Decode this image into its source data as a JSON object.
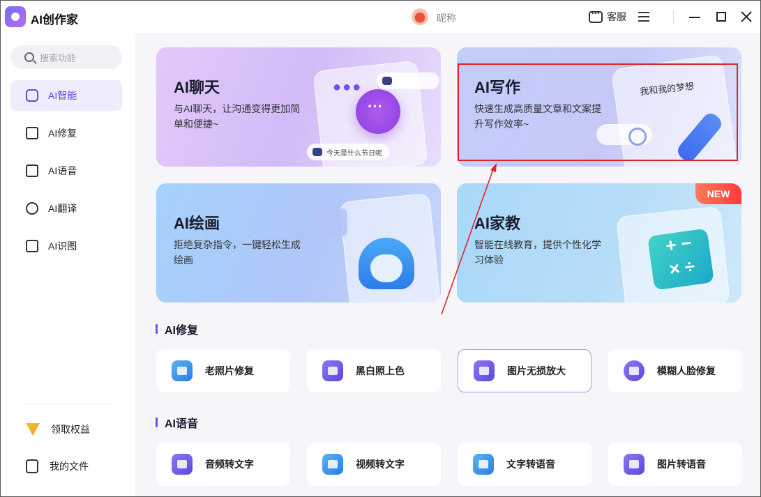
{
  "app": {
    "title": "AI创作家",
    "nickname": "昵称",
    "service_label": "客服"
  },
  "sidebar": {
    "search_placeholder": "搜索功能",
    "items": [
      {
        "label": "AI智能",
        "icon": "ai-smart-icon",
        "active": true
      },
      {
        "label": "AI修复",
        "icon": "repair-icon"
      },
      {
        "label": "AI语音",
        "icon": "voice-icon"
      },
      {
        "label": "AI翻译",
        "icon": "translate-icon"
      },
      {
        "label": "AI识图",
        "icon": "image-recognition-icon"
      }
    ],
    "bottom": [
      {
        "label": "领取权益",
        "icon": "gift-icon"
      },
      {
        "label": "我的文件",
        "icon": "file-icon"
      }
    ]
  },
  "cards": [
    {
      "title": "AI聊天",
      "desc": "与AI聊天，让沟通变得更加简单和便捷~",
      "tag": "今天是什么节日呢"
    },
    {
      "title": "AI写作",
      "desc": "快速生成高质量文章和文案提升写作效率~",
      "paper": "我和我的梦想"
    },
    {
      "title": "AI绘画",
      "desc": "拒绝复杂指令，一键轻松生成绘画"
    },
    {
      "title": "AI家教",
      "desc": "智能在线教育，提供个性化学习体验",
      "badge": "NEW",
      "calc": "+ −\n× ÷"
    }
  ],
  "sections": [
    {
      "title": "AI修复",
      "tools": [
        "老照片修复",
        "黑白照上色",
        "图片无损放大",
        "模糊人脸修复"
      ]
    },
    {
      "title": "AI语音",
      "tools": [
        "音频转文字",
        "视频转文字",
        "文字转语音",
        "图片转语音"
      ]
    }
  ],
  "colors": {
    "accent": "#5b47e8",
    "highlight": "#e02424",
    "new_badge": "#ff4a3a"
  }
}
